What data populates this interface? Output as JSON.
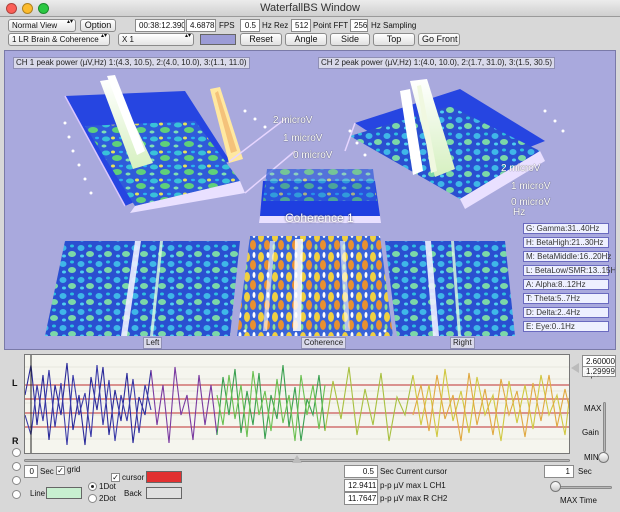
{
  "window": {
    "title": "WaterfallBS Window"
  },
  "toolbar1": {
    "view_select": "Normal View",
    "option_button": "Option",
    "time": "00:38:12.390",
    "fps_value": "4.68785",
    "fps_label": "FPS",
    "hz_rez_value": "0.5",
    "hz_rez_label": "Hz Rez",
    "fft_value": "512",
    "fft_label": "Point FFT",
    "sampling_value": "256",
    "sampling_label": "Hz Sampling"
  },
  "toolbar2": {
    "brain_select": "1 LR Brain & Coherence",
    "zoom_select": "X 1",
    "reset_button": "Reset",
    "angle_button": "Angle",
    "side_button": "Side",
    "top_button": "Top",
    "gofront_button": "Go Front",
    "swatch_color": "#9c9cd6"
  },
  "viewport": {
    "ch1_peak": "CH 1 peak power (µV,Hz) 1:(4.3, 10.5), 2:(4.0, 10.0), 3:(1.1, 11.0)",
    "ch2_peak": "CH 2 peak power (µV,Hz) 1:(4.0, 10.0), 2:(1.7, 31.0), 3:(1.5, 30.5)",
    "left_scale": [
      "2 microV",
      "1 microV",
      "0 microV"
    ],
    "right_scale": [
      "2 microV",
      "1 microV",
      "0 microV"
    ],
    "hz_label": "Hz",
    "coherence_title": "Coherence 1",
    "panel_left": "Left",
    "panel_center": "Coherence",
    "panel_right": "Right",
    "bands": [
      "G: Gamma:31..40Hz",
      "H: BetaHigh:21..30Hz",
      "M: BetaMiddle:16..20Hz",
      "L: BetaLow/SMR:13..15Hz",
      "A: Alpha:8..12Hz",
      "T: Theta:5..7Hz",
      "D: Delta:2..4Hz",
      "E: Eye:0..1Hz"
    ]
  },
  "wave": {
    "left_letter": "L",
    "right_letter": "R",
    "scale_value": "2.60000",
    "scale_unit": "0 µV",
    "scale_mid": "1.29999"
  },
  "controls": {
    "sec_value": "0",
    "sec_label": "Sec",
    "grid_label": "grid",
    "cursor_label": "cursor",
    "line_label": "Line",
    "back_label": "Back",
    "dot1_label": "1Dot",
    "dot2_label": "2Dot",
    "cursor_color": "#e23030",
    "line_color": "#c8f0d0",
    "back_color": "#e0e0e0",
    "current_cursor_value": "0.5",
    "current_cursor_label": "Sec Current cursor",
    "pp_left_value": "12.9411",
    "pp_left_label": "p-p µV max L CH1",
    "pp_right_value": "11.7647",
    "pp_right_label": "p-p µV max R CH2",
    "max_label": "MAX",
    "gain_label": "Gain",
    "min_label": "MIN",
    "maxtime_value": "1",
    "maxtime_sec": "Sec",
    "maxtime_label": "MAX Time"
  }
}
